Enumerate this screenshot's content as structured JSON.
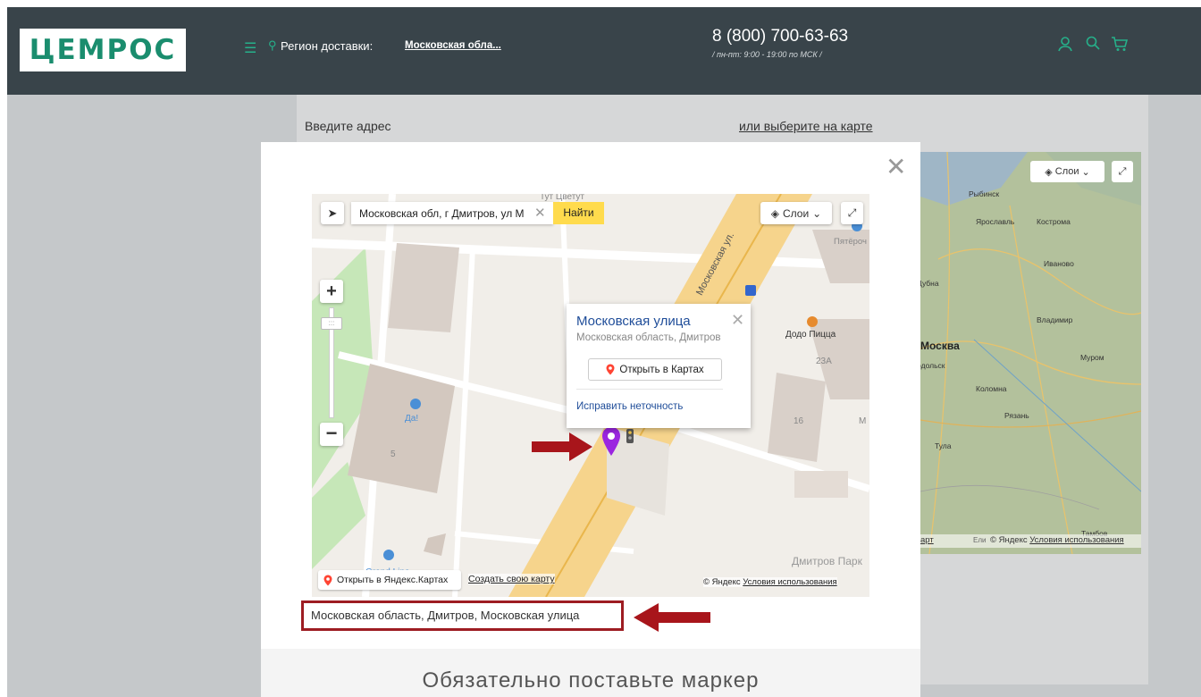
{
  "header": {
    "logo_text": "ЦЕМРОС",
    "menu_icon": "menu-icon",
    "region_label": "Регион доставки:",
    "region_value": "Московская обла...",
    "phone": "8 (800) 700-63-63",
    "hours": "/ пн-пт: 9:00 - 19:00 по МСК /",
    "icons": [
      "user-icon",
      "search-icon",
      "cart-icon"
    ],
    "accent_color": "#26b08a",
    "bg_color": "#39444a"
  },
  "background_form": {
    "address_label": "Введите адрес",
    "map_link": "или выберите на карте",
    "map": {
      "layers_label": "Слои",
      "cities": [
        "Рыбинск",
        "Ярославль",
        "Кострома",
        "Иваново",
        "Дубна",
        "Владимир",
        "Москва",
        "Подольск",
        "Муром",
        "Коломна",
        "Рязань",
        "Тула",
        "Тамбов"
      ],
      "copyright_prefix": "арт",
      "copyright_suffix": "Ели",
      "copyright": "© Яндекс",
      "terms": "Условия использования"
    }
  },
  "modal": {
    "close_icon": "close-icon",
    "map": {
      "search_value": "Московская обл, г Дмитров, ул М",
      "find_button": "Найти",
      "layers_label": "Слои",
      "zoom_in": "+",
      "zoom_out": "−",
      "street_label": "Московская ул.",
      "poi": [
        "Тут Цветут",
        "Пятёроч",
        "Додо Пицца",
        "Да!",
        "Grand Line",
        "Дмитров Парк"
      ],
      "house_numbers": [
        "23А",
        "16",
        "5",
        "М"
      ],
      "popup": {
        "title": "Московская улица",
        "subtitle": "Московская область, Дмитров",
        "open_button": "Открыть в Картах",
        "fix_link": "Исправить неточность"
      },
      "open_yandex": "Открыть в Яндекс.Картах",
      "create_map": "Создать свою карту",
      "copyright": "© Яндекс",
      "terms": "Условия использования"
    },
    "selected_address": "Московская область, Дмитров, Московская улица",
    "footer_text": "Обязательно поставьте маркер",
    "highlight_color": "#9d1c22"
  }
}
